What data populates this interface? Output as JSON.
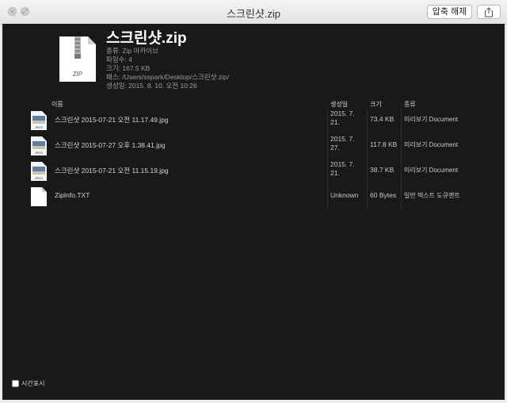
{
  "window": {
    "title": "스크린샷.zip"
  },
  "toolbar": {
    "extract_label": "압축 해제",
    "share_icon": "share-icon"
  },
  "archive": {
    "name": "스크린샷.zip",
    "icon_label": "ZIP",
    "kind": "종류: Zip 아카이브",
    "file_count": "파일수: 4",
    "size": "크기: 167.5 KB",
    "path": "패스: /Users/sspark/Desktop/스크린샷.zip/",
    "created": "생성일: 2015. 8. 10. 오전 10:26"
  },
  "table": {
    "headers": {
      "name": "이름",
      "date": "생성일",
      "size": "크기",
      "kind": "종류"
    },
    "rows": [
      {
        "name": "스크린샷 2015-07-21 오전 11.17.49.jpg",
        "date": "2015. 7. 21.",
        "size": "73.4 KB",
        "kind": "미리보기 Document",
        "icon": "jpeg-icon"
      },
      {
        "name": "스크린샷 2015-07-27 오후 1.38.41.jpg",
        "date": "2015. 7. 27.",
        "size": "117.8 KB",
        "kind": "미리보기 Document",
        "icon": "jpeg-icon"
      },
      {
        "name": "스크린샷 2015-07-21 오전 11.15.19.jpg",
        "date": "2015. 7. 21.",
        "size": "38.7 KB",
        "kind": "미리보기 Document",
        "icon": "jpeg-icon"
      },
      {
        "name": "ZipInfo.TXT",
        "date": "Unknown",
        "size": "60 Bytes",
        "kind": "일반 텍스트 도큐멘트",
        "icon": "text-file-icon"
      }
    ]
  },
  "footer": {
    "show_time_label": "시간표시",
    "show_time_checked": false
  }
}
